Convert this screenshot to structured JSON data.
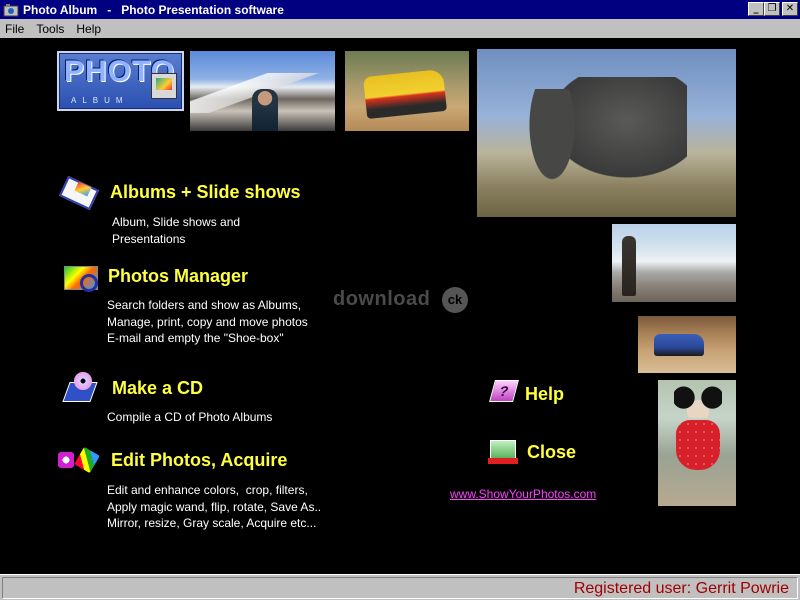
{
  "window": {
    "title": "Photo Album   -   Photo Presentation software",
    "controls": {
      "minimize": "_",
      "restore": "❐",
      "close": "✕"
    }
  },
  "menubar": {
    "items": [
      "File",
      "Tools",
      "Help"
    ]
  },
  "logo": {
    "word": "PHOTO",
    "sub": "ALBUM"
  },
  "entries": {
    "albums": {
      "title": "Albums + Slide shows",
      "description": "Album, Slide shows and\nPresentations"
    },
    "photos": {
      "title": "Photos Manager",
      "description": "Search folders and show as Albums,\nManage, print, copy and move photos\nE-mail and empty the \"Shoe-box\""
    },
    "cd": {
      "title": "Make a CD",
      "description": "Compile a CD of Photo Albums"
    },
    "edit": {
      "title": "Edit Photos, Acquire",
      "description": "Edit and enhance colors,  crop, filters,\nApply magic wand, flip, rotate, Save As..\nMirror, resize, Gray scale, Acquire etc..."
    }
  },
  "actions": {
    "help": "Help",
    "close": "Close"
  },
  "link": {
    "url_text": "www.ShowYourPhotos.com"
  },
  "watermark": {
    "text": "download",
    "badge": "ck"
  },
  "status": {
    "text": "Registered user: Gerrit Powrie"
  },
  "colors": {
    "title_bar": "#000080",
    "entry_title": "#ffff40",
    "link": "#ff40ff",
    "status_text": "#a00000"
  }
}
